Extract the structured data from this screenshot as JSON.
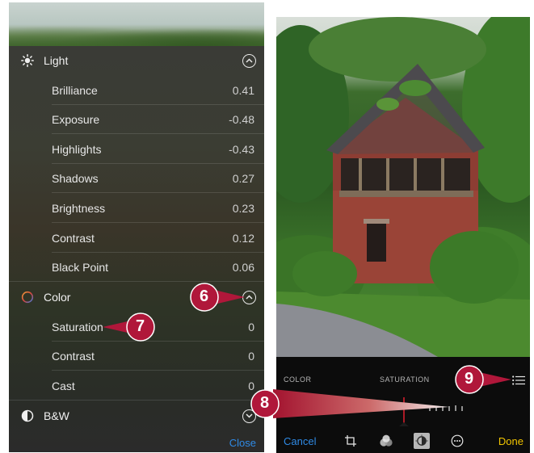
{
  "left_panel": {
    "light": {
      "title": "Light",
      "items": [
        {
          "label": "Brilliance",
          "value": "0.41"
        },
        {
          "label": "Exposure",
          "value": "-0.48"
        },
        {
          "label": "Highlights",
          "value": "-0.43"
        },
        {
          "label": "Shadows",
          "value": "0.27"
        },
        {
          "label": "Brightness",
          "value": "0.23"
        },
        {
          "label": "Contrast",
          "value": "0.12"
        },
        {
          "label": "Black Point",
          "value": "0.06"
        }
      ]
    },
    "color": {
      "title": "Color",
      "items": [
        {
          "label": "Saturation",
          "value": "0"
        },
        {
          "label": "Contrast",
          "value": "0"
        },
        {
          "label": "Cast",
          "value": "0"
        }
      ]
    },
    "bw": {
      "title": "B&W"
    },
    "close_label": "Close"
  },
  "right_panel": {
    "color_label": "COLOR",
    "saturation_label": "SATURATION",
    "cancel_label": "Cancel",
    "done_label": "Done",
    "icons": [
      "crop-icon",
      "filters-icon",
      "adjust-icon",
      "more-icon",
      "list-icon"
    ]
  },
  "callouts": [
    "6",
    "7",
    "8",
    "9"
  ],
  "colors": {
    "accent_blue": "#2f8ae5",
    "done_yellow": "#f2c500",
    "callout_red": "#b0173a",
    "slider_red": "#e01e2e"
  }
}
